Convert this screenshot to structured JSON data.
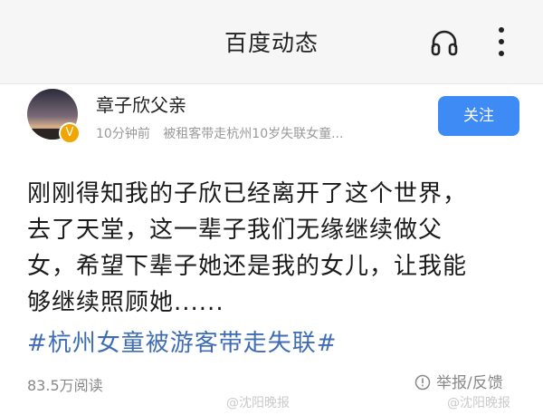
{
  "header": {
    "title": "百度动态",
    "listen_icon": "headphones-icon",
    "more_icon": "vertical-ellipsis-icon"
  },
  "author": {
    "name": "章子欣父亲",
    "time": "10分钟前",
    "source": "被租客带走杭州10岁失联女童...",
    "follow_label": "关注",
    "verified_badge": "V"
  },
  "post": {
    "lines": [
      "刚刚得知我的子欣已经离开了这个世界，",
      "去了天堂，这一辈子我们无缘继续做父",
      "女，希望下辈子她还是我的女儿，让我能",
      "够继续照顾她......"
    ],
    "hashtag": "#杭州女童被游客带走失联#"
  },
  "footer": {
    "reads": "83.5万阅读",
    "report_label": "举报/反馈"
  },
  "watermarks": {
    "left": "@沈阳晚报",
    "right": "@沈阳晚报"
  },
  "colors": {
    "accent": "#3e8bf5",
    "hashtag": "#3e6db5",
    "verified": "#f2a500"
  }
}
